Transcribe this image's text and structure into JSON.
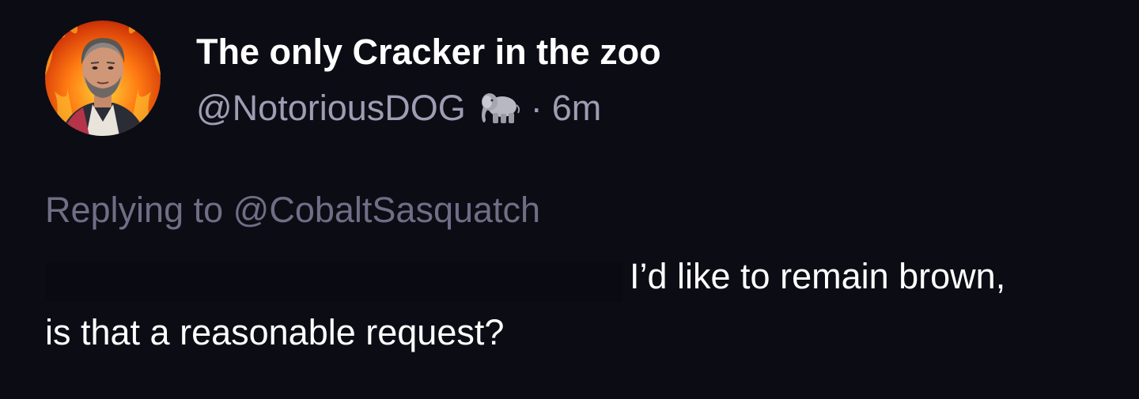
{
  "author": {
    "display_name": "The only Cracker in the zoo",
    "handle": "@NotoriousDOG",
    "badge_icon": "elephant-icon",
    "separator": "·",
    "timestamp": "6m"
  },
  "reply": {
    "prefix": "Replying to",
    "target_handle": "@CobaltSasquatch"
  },
  "body": {
    "line1": "I’d like to remain brown,",
    "line2": "is that a reasonable request?"
  },
  "colors": {
    "background": "#0c0c15",
    "primary_text": "#ffffff",
    "secondary_text": "#9d9db3",
    "muted_text": "#6e6e86"
  }
}
